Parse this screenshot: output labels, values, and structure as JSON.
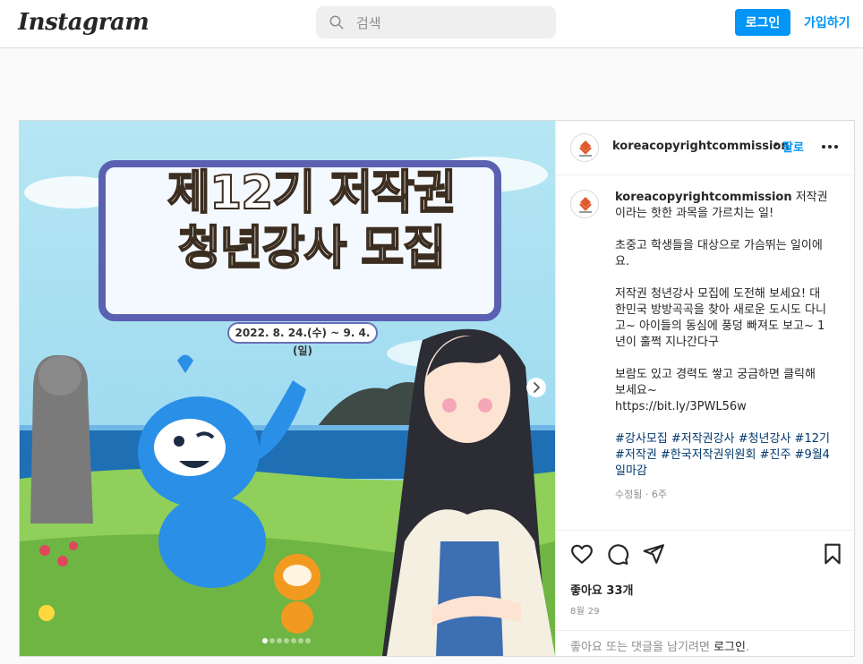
{
  "header": {
    "logo": "Instagram",
    "search_placeholder": "검색",
    "login_label": "로그인",
    "signup_label": "가입하기"
  },
  "post": {
    "username": "koreacopyrightcommission",
    "dot": "•",
    "follow_label": "팔로",
    "caption_user": "koreacopyrightcommission",
    "caption_lines": [
      " 저작권이라는 핫한 과목을 가르치는 일!",
      "초중고 학생들을 대상으로 가슴뛰는 일이에요.",
      "저작권 청년강사 모집에 도전해 보세요! 대한민국 방방곡곡을 찾아 새로운 도시도 다니고~ 아이들의 동심에 풍덩 빠져도 보고~ 1년이 훌쩍 지나간다구",
      "보람도 있고 경력도 쌓고 궁금하면 클릭해 보세요~"
    ],
    "link": "https://bit.ly/3PWL56w",
    "hashtags": "#강사모집 #저작권강사 #청년강사 #12기 #저작권 #한국저작권위원회 #진주 #9월4일마감",
    "edited": "수정됨 · 6주",
    "likes": "좋아요 33개",
    "date": "8월 29",
    "comment_prompt": "좋아요 또는 댓글을 남기려면 ",
    "comment_login": "로그인",
    "comment_end": "."
  },
  "media": {
    "title_line1": "제12기 저작권",
    "title_line2": "청년강사 모집",
    "date_range": "2022. 8. 24.(수) ~ 9. 4.(일)",
    "slide_count": 7,
    "current_slide": 1
  },
  "colors": {
    "accent": "#0095f6",
    "sky": "#a8def0",
    "sea": "#1f6fb5",
    "grass": "#8fcf5a",
    "frame": "#5b60b0"
  }
}
